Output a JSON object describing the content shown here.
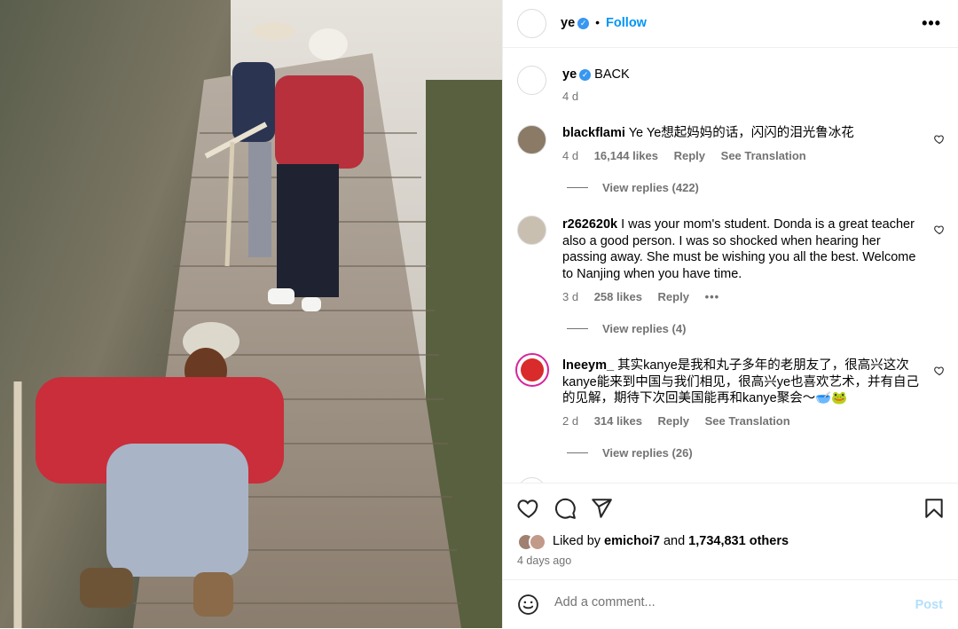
{
  "post": {
    "author": "ye",
    "follow_label": "Follow",
    "caption_user": "ye",
    "caption_text": "BACK",
    "caption_time": "4 d"
  },
  "comments": [
    {
      "user": "blackflami",
      "text": "Ye Ye想起妈妈的话，闪闪的泪光鲁冰花",
      "time": "4 d",
      "likes": "16,144 likes",
      "reply": "Reply",
      "translate": "See Translation",
      "view_replies": "View replies (422)"
    },
    {
      "user": "r262620k",
      "text": "I was your mom's student. Donda is a great teacher also a good person. I was so shocked when hearing her passing away. She must be wishing you all the best. Welcome to Nanjing when you have time.",
      "time": "3 d",
      "likes": "258 likes",
      "reply": "Reply",
      "view_replies": "View replies (4)"
    },
    {
      "user": "lneeym_",
      "text": "其实kanye是我和丸子多年的老朋友了，很高兴这次kanye能来到中国与我们相见，很高兴ye也喜欢艺术，并有自己的见解，期待下次回美国能再和kanye聚会～🥣🐸",
      "time": "2 d",
      "likes": "314 likes",
      "reply": "Reply",
      "translate": "See Translation",
      "view_replies": "View replies (26)"
    }
  ],
  "footer": {
    "liked_by_prefix": "Liked by",
    "liked_by_user": "emichoi7",
    "and": "and",
    "others": "1,734,831 others",
    "time_ago": "4 days ago",
    "add_comment_placeholder": "Add a comment...",
    "post_label": "Post"
  },
  "icons": {
    "like": "heart-icon",
    "comment": "comment-icon",
    "share": "send-icon",
    "save": "bookmark-icon",
    "emoji": "emoji-icon",
    "more": "more-options-icon",
    "verified": "verified-badge-icon"
  },
  "colors": {
    "link": "#0095f6",
    "verified": "#3897f0",
    "muted": "#737373",
    "post_disabled": "#b2dffc"
  }
}
